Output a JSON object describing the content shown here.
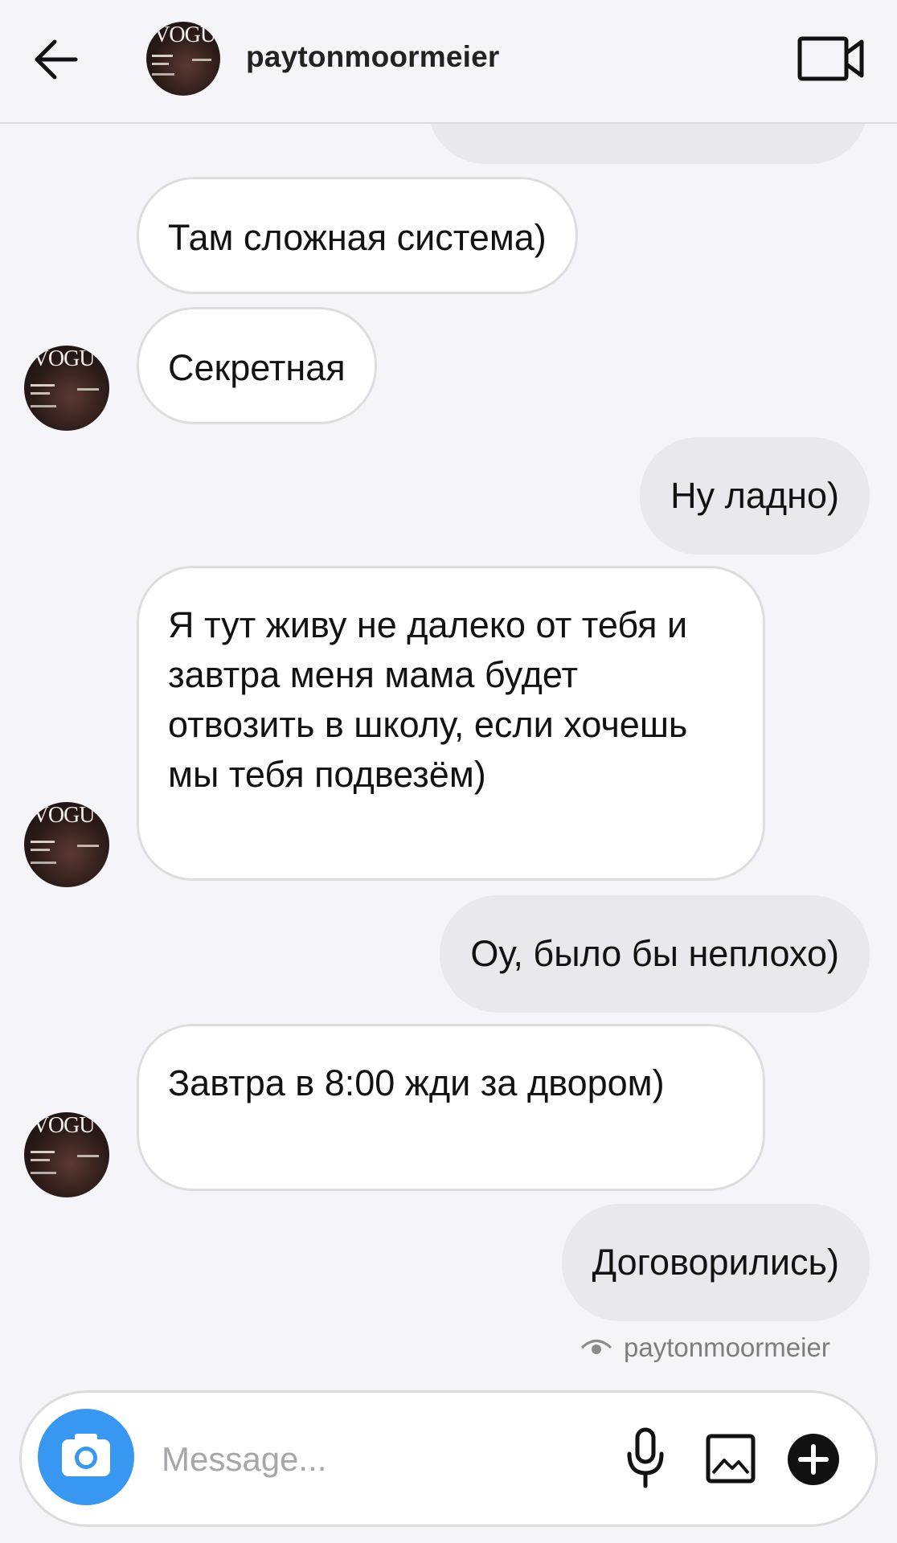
{
  "header": {
    "username": "paytonmoormeier",
    "back_icon": "arrow-left-icon",
    "video_icon": "video-camera-icon",
    "avatar_text": "VOGUE"
  },
  "messages": [
    {
      "dir": "in",
      "text": "Там сложная система)"
    },
    {
      "dir": "in",
      "text": "Секретная"
    },
    {
      "dir": "out",
      "text": "Ну ладно)"
    },
    {
      "dir": "in",
      "text": "Я тут живу не далеко от тебя и завтра меня мама будет отвозить в школу, если хочешь мы тебя подвезём)"
    },
    {
      "dir": "out",
      "text": "Оу, было бы неплохо)"
    },
    {
      "dir": "in",
      "text": "Завтра в 8:00 жди за двором)"
    },
    {
      "dir": "out",
      "text": "Договорились)"
    }
  ],
  "seen": {
    "icon": "eye-icon",
    "by": "paytonmoormeier"
  },
  "composer": {
    "placeholder": "Message...",
    "camera_icon": "camera-icon",
    "mic_icon": "microphone-icon",
    "gallery_icon": "image-gallery-icon",
    "plus_icon": "plus-circle-icon"
  },
  "colors": {
    "background": "#f5f4f8",
    "incoming_bubble": "#ffffff",
    "outgoing_bubble": "#e9e8ec",
    "camera_button": "#3897f0"
  }
}
